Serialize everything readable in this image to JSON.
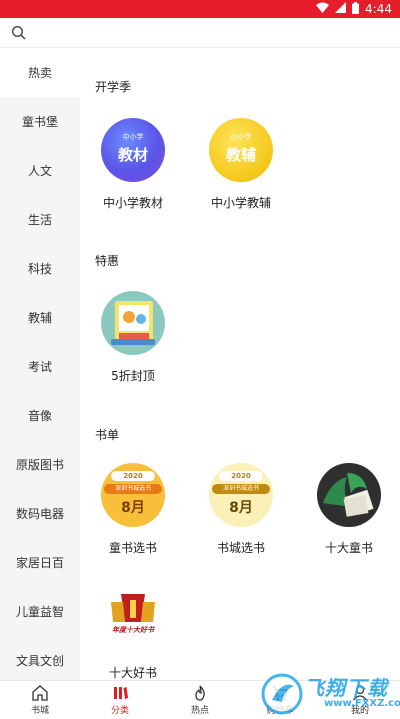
{
  "status_bar": {
    "time": "4:44",
    "icons": [
      "wifi-icon",
      "signal-icon",
      "battery-icon"
    ]
  },
  "search": {
    "icon": "search-icon"
  },
  "sidebar": {
    "items": [
      {
        "label": "热卖"
      },
      {
        "label": "童书堡"
      },
      {
        "label": "人文"
      },
      {
        "label": "生活"
      },
      {
        "label": "科技"
      },
      {
        "label": "教辅"
      },
      {
        "label": "考试"
      },
      {
        "label": "音像"
      },
      {
        "label": "原版图书"
      },
      {
        "label": "数码电器"
      },
      {
        "label": "家居日百"
      },
      {
        "label": "儿童益智"
      },
      {
        "label": "文具文创"
      }
    ],
    "active_index": 0
  },
  "sections": [
    {
      "title": "开学季",
      "items": [
        {
          "label": "中小学教材",
          "img_small": "中小学",
          "img_big": "教材"
        },
        {
          "label": "中小学教辅",
          "img_small": "小小学",
          "img_big": "教辅"
        }
      ]
    },
    {
      "title": "特惠",
      "items": [
        {
          "label": "5折封顶"
        }
      ]
    },
    {
      "title": "书单",
      "items": [
        {
          "label": "童书选书",
          "badge_year": "2020",
          "badge_line": "深圳书城选书",
          "badge_month": "8月"
        },
        {
          "label": "书城选书",
          "badge_year": "2020",
          "badge_line": "深圳书城选书",
          "badge_month": "8月"
        },
        {
          "label": "十大童书"
        },
        {
          "label": "十大好书",
          "logo_text": "年度十大好书"
        }
      ]
    }
  ],
  "bottom_nav": {
    "tabs": [
      {
        "label": "书城",
        "icon": "home-icon"
      },
      {
        "label": "分类",
        "icon": "category-icon"
      },
      {
        "label": "热点",
        "icon": "flame-icon"
      },
      {
        "label": "购物车",
        "icon": "cart-icon"
      },
      {
        "label": "我的",
        "icon": "user-icon"
      }
    ],
    "active_index": 1
  },
  "watermark": {
    "text": "飞翔下载",
    "sub": "www.FXXZ.com"
  },
  "colors": {
    "accent": "#e02020",
    "status_bar": "#e61e2b",
    "sidebar_bg": "#f5f5f5"
  }
}
